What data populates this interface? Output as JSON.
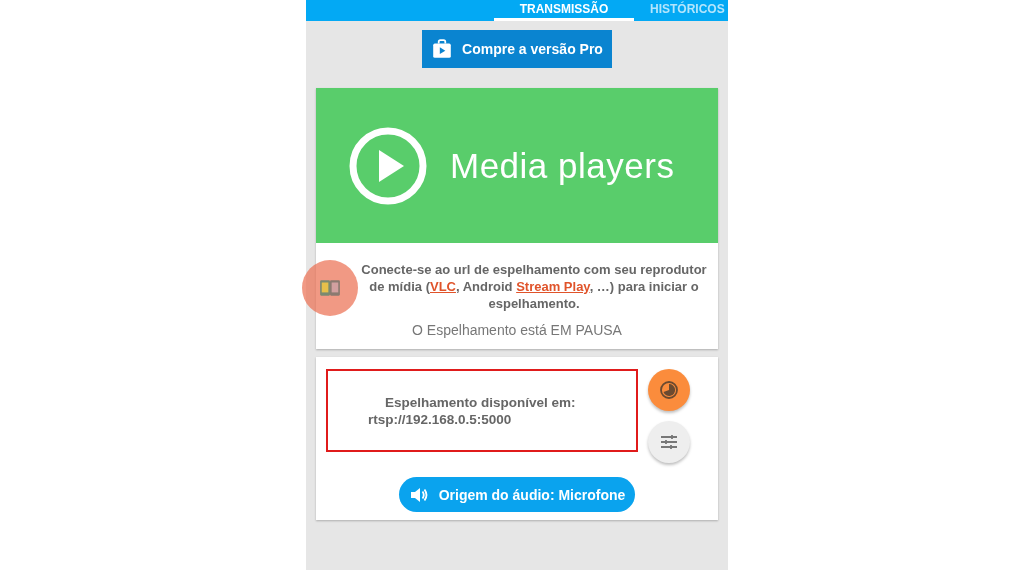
{
  "tabs": [
    {
      "label": "TRANSMISSÃO",
      "selected": true
    },
    {
      "label": "HISTÓRICOS",
      "selected": false
    }
  ],
  "pro_button": {
    "label": "Compre a versão Pro"
  },
  "banner": {
    "title": "Media players"
  },
  "description": {
    "parts": [
      {
        "kind": "text",
        "text": "Conecte-se ao url de espelhamento com seu reprodutor de mídia ("
      },
      {
        "kind": "link",
        "text": "VLC"
      },
      {
        "kind": "text",
        "text": ", Android "
      },
      {
        "kind": "link",
        "text": "Stream Play"
      },
      {
        "kind": "text",
        "text": ", …) para iniciar o espelhamento."
      }
    ]
  },
  "status": "O Espelhamento está EM PAUSA",
  "mirror": {
    "label": "Espelhamento disponível em:",
    "url": "rtsp://192.168.0.5:5000"
  },
  "audio_button": {
    "label": "Origem do áudio: Microfone"
  }
}
